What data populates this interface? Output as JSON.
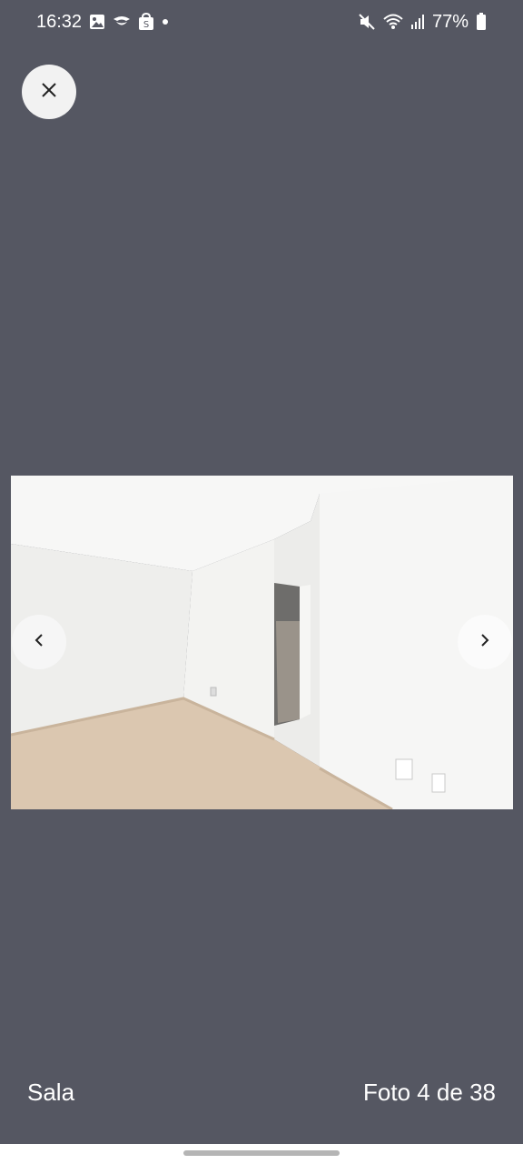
{
  "status_bar": {
    "time": "16:32",
    "battery": "77%",
    "left_icons": [
      "gallery-icon",
      "messenger-icon",
      "shopee-icon",
      "dot-icon"
    ],
    "right_icons": [
      "mute-icon",
      "wifi-icon",
      "signal-icon",
      "battery-icon"
    ]
  },
  "viewer": {
    "close_icon": "close-icon",
    "prev_icon": "chevron-left-icon",
    "next_icon": "chevron-right-icon",
    "caption": "Sala",
    "counter": "Foto 4 de 38"
  },
  "colors": {
    "background": "#555762",
    "button": "#f6f6f6"
  }
}
